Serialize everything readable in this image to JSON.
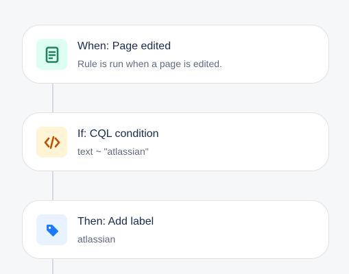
{
  "steps": [
    {
      "kind": "trigger",
      "title": "When: Page edited",
      "subtitle": "Rule is run when a page is edited.",
      "icon": "page-document-icon",
      "icon_bg": "#dcfff1",
      "icon_color": "#1f845a"
    },
    {
      "kind": "condition",
      "title": "If: CQL condition",
      "subtitle": "text ~ \"atlassian\"",
      "icon": "code-icon",
      "icon_bg": "#fff4d6",
      "icon_color": "#c25100"
    },
    {
      "kind": "action",
      "title": "Then: Add label",
      "subtitle": "atlassian",
      "icon": "label-tag-icon",
      "icon_bg": "#e9f2ff",
      "icon_color": "#1d7afc"
    }
  ]
}
